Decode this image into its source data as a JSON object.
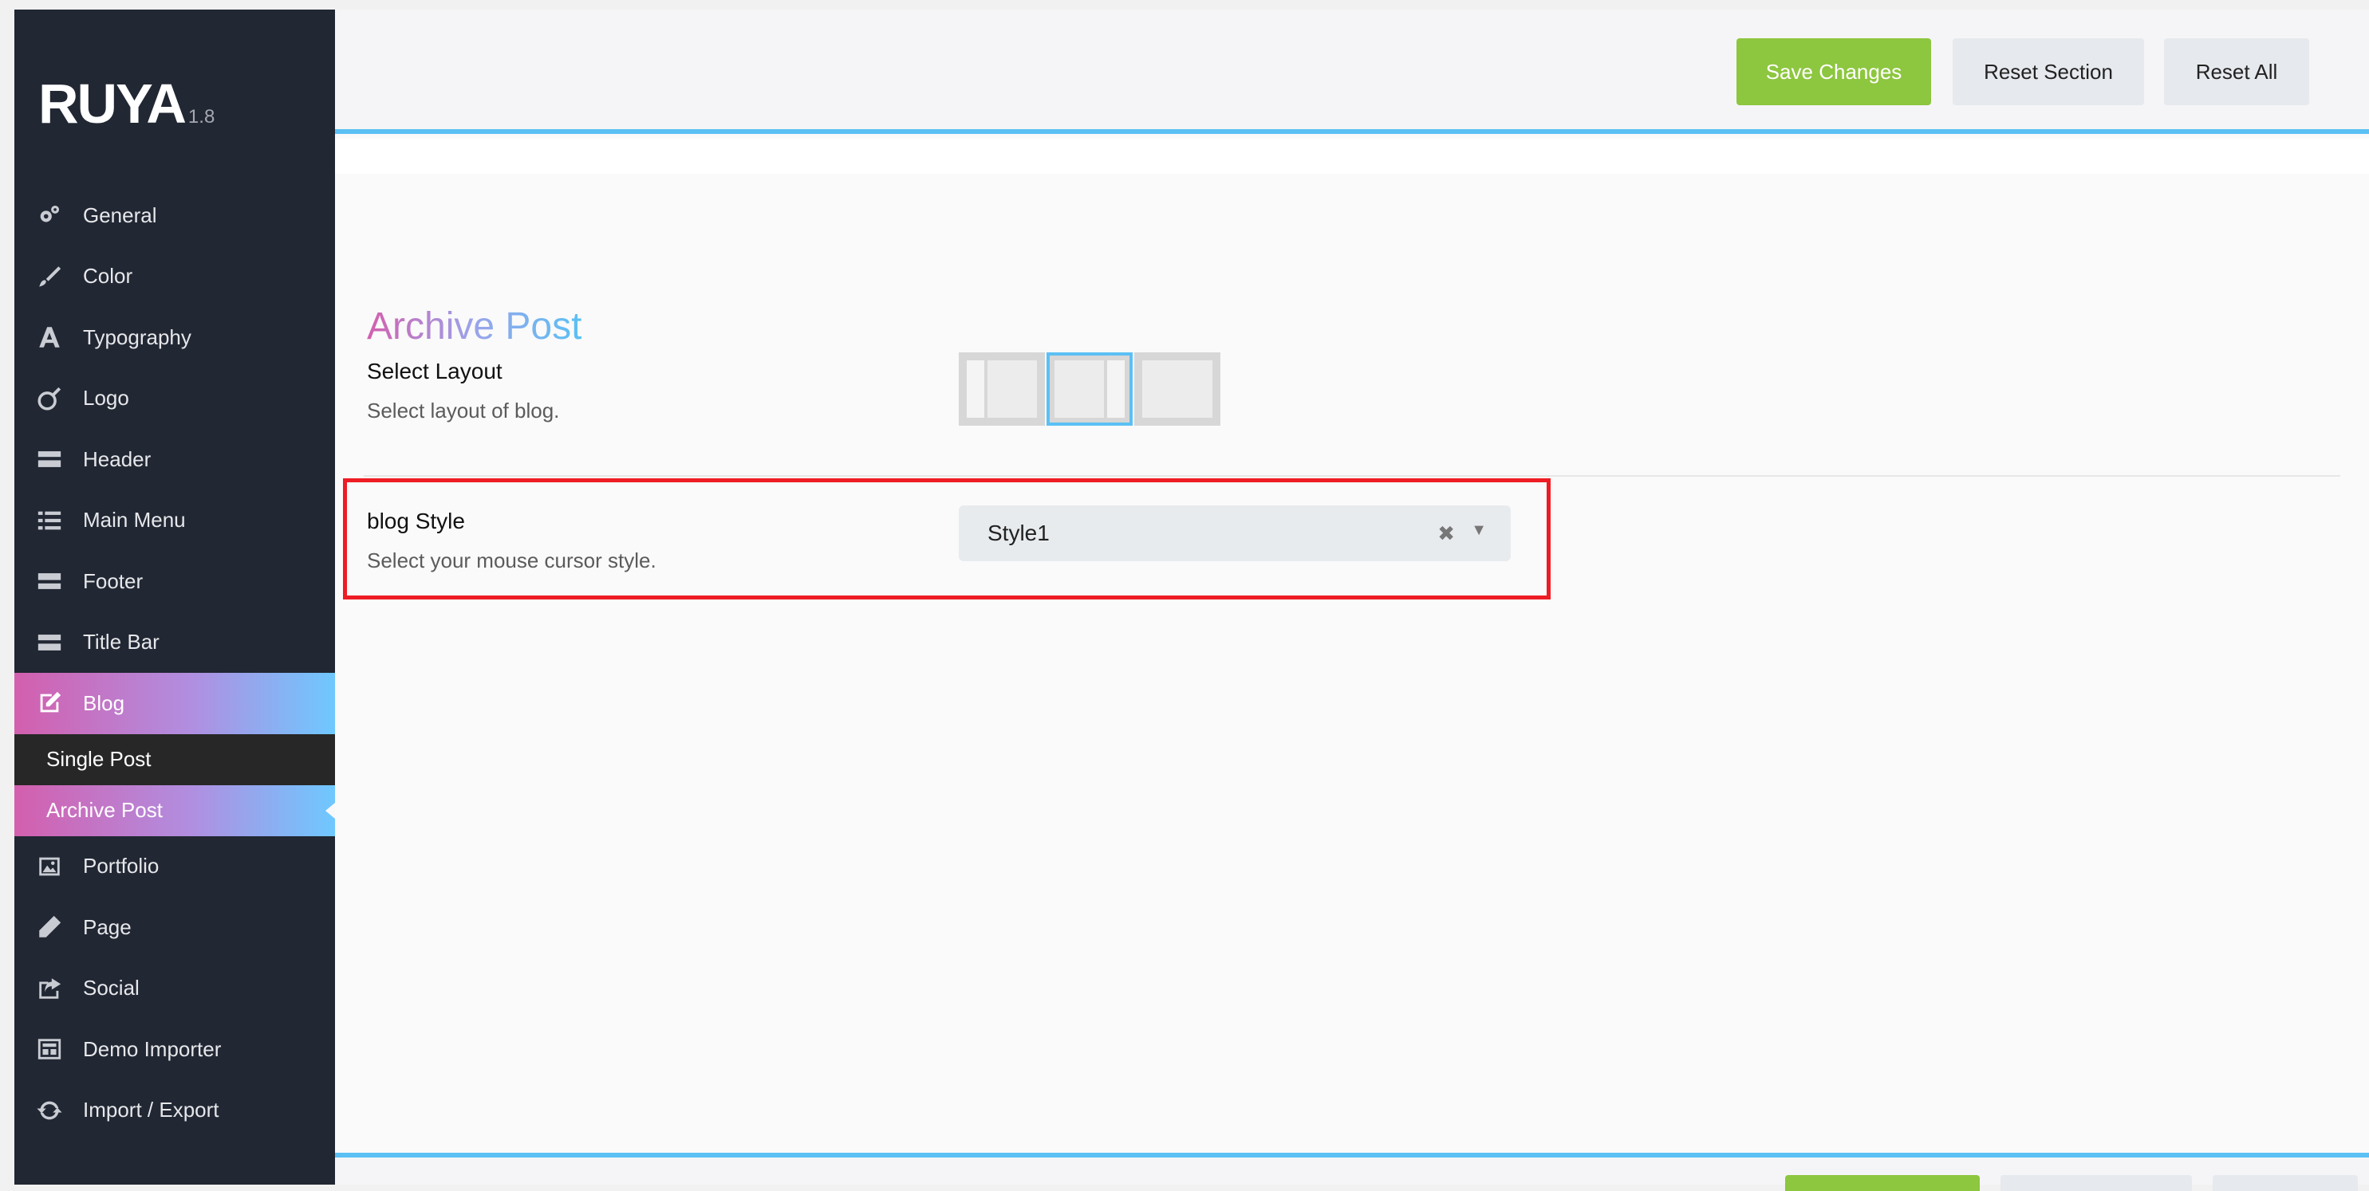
{
  "brand": {
    "name": "RUYA",
    "version": "1.8"
  },
  "sidebar": {
    "items": [
      {
        "label": "General",
        "icon": "gears-icon"
      },
      {
        "label": "Color",
        "icon": "brush-icon"
      },
      {
        "label": "Typography",
        "icon": "font-icon"
      },
      {
        "label": "Logo",
        "icon": "logo-icon"
      },
      {
        "label": "Header",
        "icon": "header-icon"
      },
      {
        "label": "Main Menu",
        "icon": "list-icon"
      },
      {
        "label": "Footer",
        "icon": "footer-icon"
      },
      {
        "label": "Title Bar",
        "icon": "titlebar-icon"
      },
      {
        "label": "Blog",
        "icon": "edit-icon",
        "active": true
      },
      {
        "label": "Portfolio",
        "icon": "image-icon"
      },
      {
        "label": "Page",
        "icon": "pencil-icon"
      },
      {
        "label": "Social",
        "icon": "share-icon"
      },
      {
        "label": "Demo Importer",
        "icon": "demo-icon"
      },
      {
        "label": "Import / Export",
        "icon": "refresh-icon"
      }
    ],
    "blog_submenu": [
      {
        "label": "Single Post"
      },
      {
        "label": "Archive Post",
        "current": true
      }
    ]
  },
  "toolbar": {
    "save_label": "Save Changes",
    "reset_section_label": "Reset Section",
    "reset_all_label": "Reset All"
  },
  "section": {
    "title": "Archive Post",
    "fields": [
      {
        "label": "Select Layout",
        "description": "Select layout of blog.",
        "options": [
          "left-sidebar",
          "right-sidebar",
          "no-sidebar"
        ],
        "selected_index": 1
      },
      {
        "label": "blog Style",
        "description": "Select your mouse cursor style.",
        "value": "Style1"
      }
    ]
  },
  "colors": {
    "sidebar_bg": "#212733",
    "accent_blue": "#5bc0f4",
    "accent_pink": "#d35fae",
    "save_green": "#8dc63f",
    "highlight_red": "#ee1c24"
  }
}
